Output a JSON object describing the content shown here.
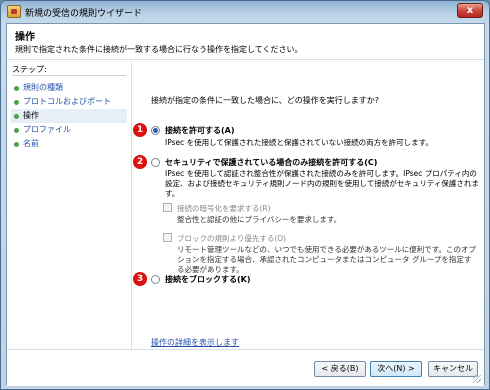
{
  "window": {
    "title": "新規の受信の規則ウイザード",
    "close_glyph": "x"
  },
  "header": {
    "title": "操作",
    "description": "規則で指定された条件に接続が一致する場合に行なう操作を指定してください。"
  },
  "sidebar": {
    "steps_title": "ステップ:",
    "items": [
      {
        "label": "規則の種類"
      },
      {
        "label": "プロトコルおよびポート"
      },
      {
        "label": "操作"
      },
      {
        "label": "プロファイル"
      },
      {
        "label": "名前"
      }
    ]
  },
  "main": {
    "question": "接続が指定の条件に一致した場合に、どの操作を実行しますか?",
    "options": [
      {
        "badge": "1",
        "label": "接続を許可する(A)",
        "description": "IPsec を使用して保護された接続と保護されていない接続の両方を許可します。"
      },
      {
        "badge": "2",
        "label": "セキュリティで保護されている場合のみ接続を許可する(C)",
        "description": "IPsec を使用して認証され整合性が保護された接続のみを許可します。IPsec プロパティ内の設定、および接続セキュリティ規則ノード内の規則を使用して接続がセキュリティ保護されます。"
      },
      {
        "badge": "3",
        "label": "接続をブロックする(K)",
        "description": ""
      }
    ],
    "sub_options": [
      {
        "label": "接続の暗号化を要求する(R)",
        "description": "整合性と認証の他にプライバシーを要求します。"
      },
      {
        "label": "ブロックの規則より優先する(O)",
        "description": "リモート管理ツールなどの、いつでも使用できる必要があるツールに便利です。このオプションを指定する場合、承認されたコンピュータまたはコンピュータ グループを指定する必要があります。"
      }
    ],
    "details_link": "操作の詳細を表示します"
  },
  "footer": {
    "back_label": "< 戻る(B)",
    "next_label": "次へ(N) >",
    "cancel_label": "キャンセル"
  }
}
